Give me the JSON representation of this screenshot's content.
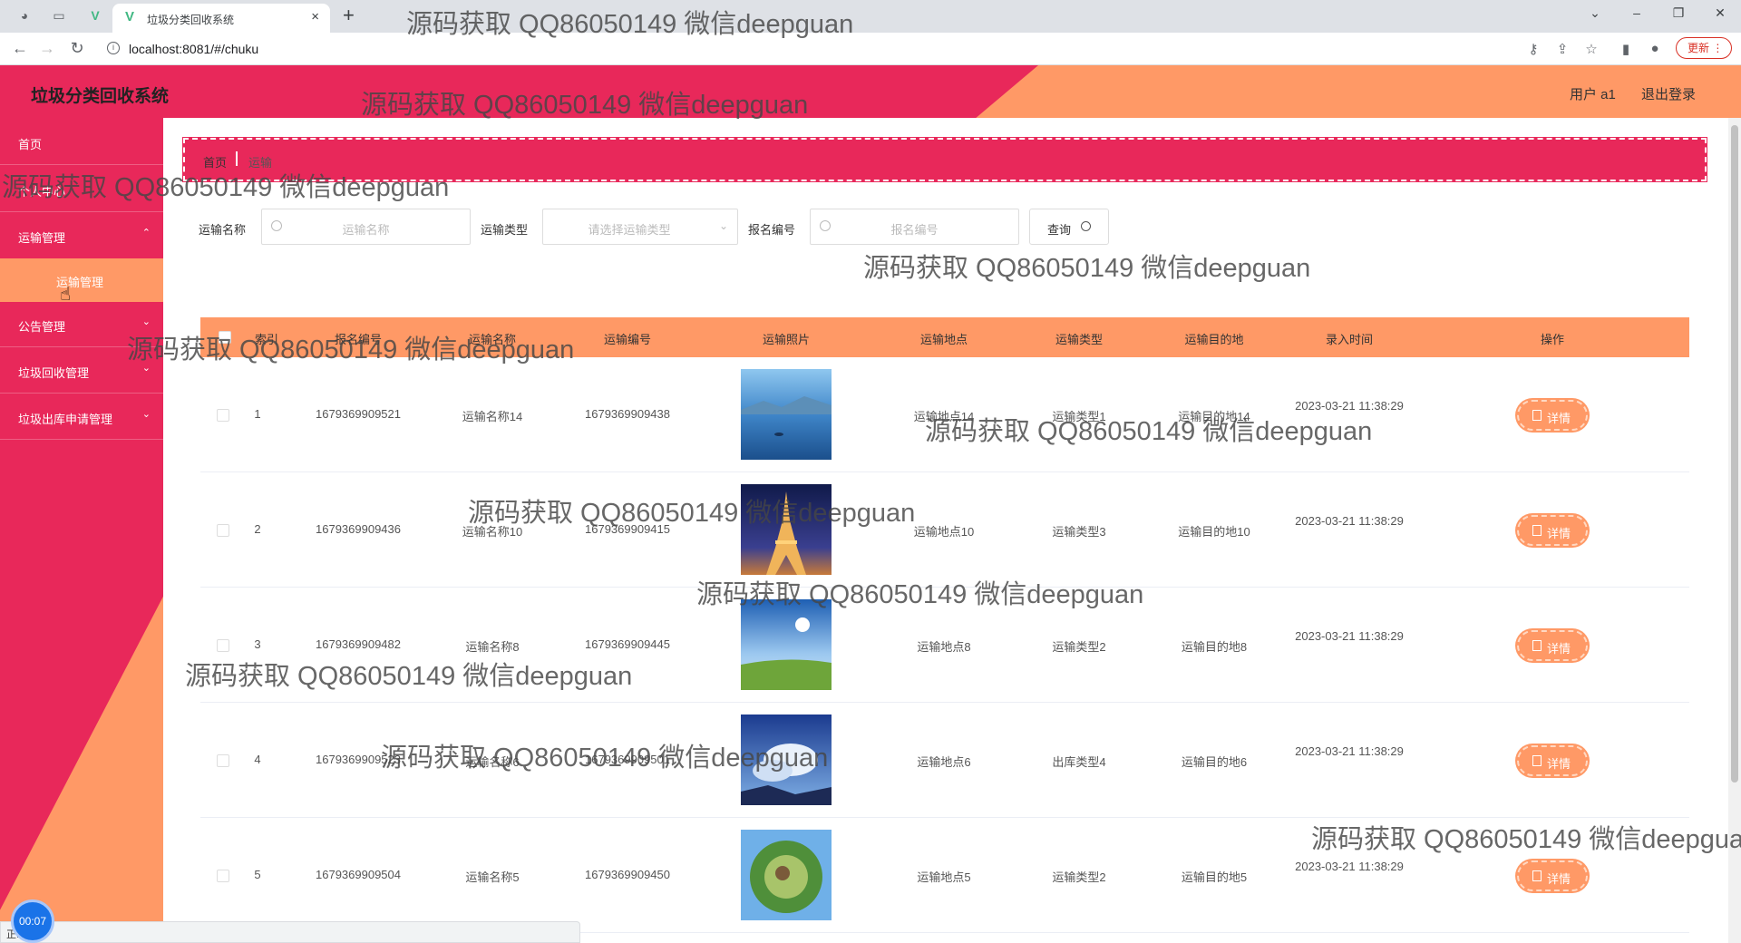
{
  "browser": {
    "tab_title": "垃圾分类回收系统",
    "url": "localhost:8081/#/chuku",
    "update_label": "更新"
  },
  "header": {
    "app_title": "垃圾分类回收系统",
    "user_label": "用户 a1",
    "logout_label": "退出登录"
  },
  "sidebar": {
    "items": [
      {
        "label": "首页"
      },
      {
        "label": "个人中心"
      },
      {
        "label": "运输管理"
      },
      {
        "label": "公告管理"
      },
      {
        "label": "垃圾回收管理"
      },
      {
        "label": "垃圾出库申请管理"
      }
    ],
    "active_sub": "运输管理"
  },
  "breadcrumb": {
    "home": "首页",
    "current": "运输"
  },
  "search": {
    "name_label": "运输名称",
    "name_placeholder": "运输名称",
    "type_label": "运输类型",
    "type_placeholder": "请选择运输类型",
    "code_label": "报名编号",
    "code_placeholder": "报名编号",
    "query_label": "查询"
  },
  "table": {
    "headers": [
      "索引",
      "报名编号",
      "运输名称",
      "运输编号",
      "运输照片",
      "运输地点",
      "运输类型",
      "运输目的地",
      "录入时间",
      "操作"
    ],
    "detail_label": "详情",
    "rows": [
      {
        "index": "1",
        "code": "1679369909521",
        "name": "运输名称14",
        "tcode": "1679369909438",
        "place": "运输地点14",
        "type": "运输类型1",
        "dest": "运输目的地14",
        "time": "2023-03-21 11:38:29",
        "photo": "lake"
      },
      {
        "index": "2",
        "code": "1679369909436",
        "name": "运输名称10",
        "tcode": "1679369909415",
        "place": "运输地点10",
        "type": "运输类型3",
        "dest": "运输目的地10",
        "time": "2023-03-21 11:38:29",
        "photo": "eiffel"
      },
      {
        "index": "3",
        "code": "1679369909482",
        "name": "运输名称8",
        "tcode": "1679369909445",
        "place": "运输地点8",
        "type": "运输类型2",
        "dest": "运输目的地8",
        "time": "2023-03-21 11:38:29",
        "photo": "meadow"
      },
      {
        "index": "4",
        "code": "1679369909523",
        "name": "运输名称6",
        "tcode": "1679369909501",
        "place": "运输地点6",
        "type": "出库类型4",
        "dest": "运输目的地6",
        "time": "2023-03-21 11:38:29",
        "photo": "clouds"
      },
      {
        "index": "5",
        "code": "1679369909504",
        "name": "运输名称5",
        "tcode": "1679369909450",
        "place": "运输地点5",
        "type": "运输类型2",
        "dest": "运输目的地5",
        "time": "2023-03-21 11:38:29",
        "photo": "planet"
      }
    ]
  },
  "status": {
    "text": "正...",
    "recording": "00:07"
  },
  "watermark": "源码获取 QQ86050149 微信deepguan",
  "colors": {
    "primary": "#e8285a",
    "accent": "#ff9966"
  }
}
